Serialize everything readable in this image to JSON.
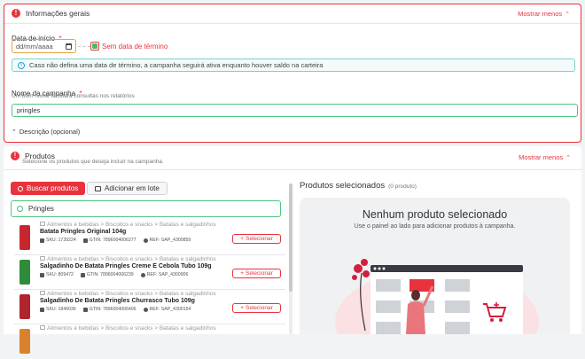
{
  "general": {
    "title": "Informações gerais",
    "toggle": "Mostrar menos",
    "start_date_label": "Data de início",
    "required_mark": "*",
    "date_placeholder": "dd/mm/aaaa",
    "no_end_date": "Sem data de término",
    "info_text": "Caso não defina uma data de término, a campanha seguirá ativa enquanto houver saldo na carteira",
    "name_label": "Nome da campanha",
    "name_hint": "Um bom nome facilitará consultas nos relatórios",
    "name_value": "pringles",
    "description_toggle": "Descrição (opcional)"
  },
  "products": {
    "title": "Produtos",
    "subtitle": "Selecione os produtos que deseja incluir na campanha.",
    "toggle": "Mostrar menos",
    "search_button": "Buscar produtos",
    "batch_button": "Adicionar em lote",
    "search_value": "Pringles",
    "items": [
      {
        "path": "Alimentos e bebidas > Biscoitos e snacks > Batatas e salgadinhos",
        "name": "Batata Pringles Original 104g",
        "sku": "SKU: 1739224",
        "gtin": "GTIN: 7896004006277",
        "ref": "REF: SAP_4300859",
        "color": "#c8262f",
        "action": "Selecionar"
      },
      {
        "path": "Alimentos e bebidas > Biscoitos e snacks > Batatas e salgadinhos",
        "name": "Salgadinho De Batata Pringles Creme E Cebola Tubo 109g",
        "sku": "SKU: 809472",
        "gtin": "GTIN: 7896004006239",
        "ref": "REF: SAP_4300906",
        "color": "#2e8b3a",
        "action": "Selecionar"
      },
      {
        "path": "Alimentos e bebidas > Biscoitos e snacks > Batatas e salgadinhos",
        "name": "Salgadinho De Batata Pringles Churrasco Tubo 109g",
        "sku": "SKU: 1846036",
        "gtin": "GTIN: 7896004006406",
        "ref": "REF: SAP_4300154",
        "color": "#b0242c",
        "action": "Selecionar"
      },
      {
        "path": "Alimentos e bebidas > Biscoitos e snacks > Batatas e salgadinhos",
        "name": "",
        "sku": "",
        "gtin": "",
        "ref": "",
        "color": "#d9822b",
        "action": ""
      }
    ],
    "selected_title": "Produtos selecionados",
    "selected_count": "(0 produto)",
    "empty_title": "Nenhum produto selecionado",
    "empty_hint": "Use o painel ao lado para adicionar produtos à campanha."
  },
  "colors": {
    "accent": "#e8333d",
    "success": "#3fbf6f",
    "info": "#1e9fd6"
  }
}
